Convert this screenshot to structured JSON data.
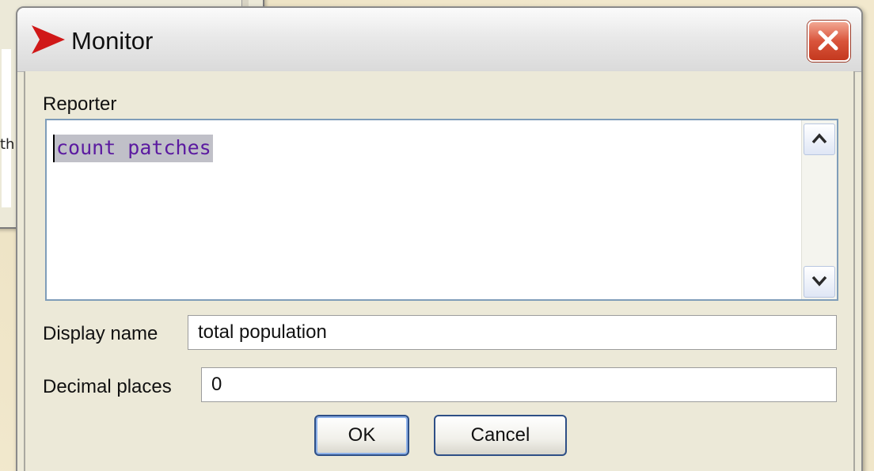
{
  "background": {
    "fragment_text": "th"
  },
  "dialog": {
    "title": "Monitor",
    "title_icon": "netlogo-arrow-icon",
    "close_icon": "close-icon",
    "reporter_label": "Reporter",
    "reporter_code": "count patches",
    "display_name_label": "Display name",
    "display_name_value": "total population",
    "decimal_places_label": "Decimal places",
    "decimal_places_value": "0",
    "ok_label": "OK",
    "cancel_label": "Cancel"
  },
  "colors": {
    "code_text": "#5b1aa0",
    "selection": "#c0c0c8",
    "close_button": "#d9543b",
    "button_border": "#2e4f86"
  }
}
